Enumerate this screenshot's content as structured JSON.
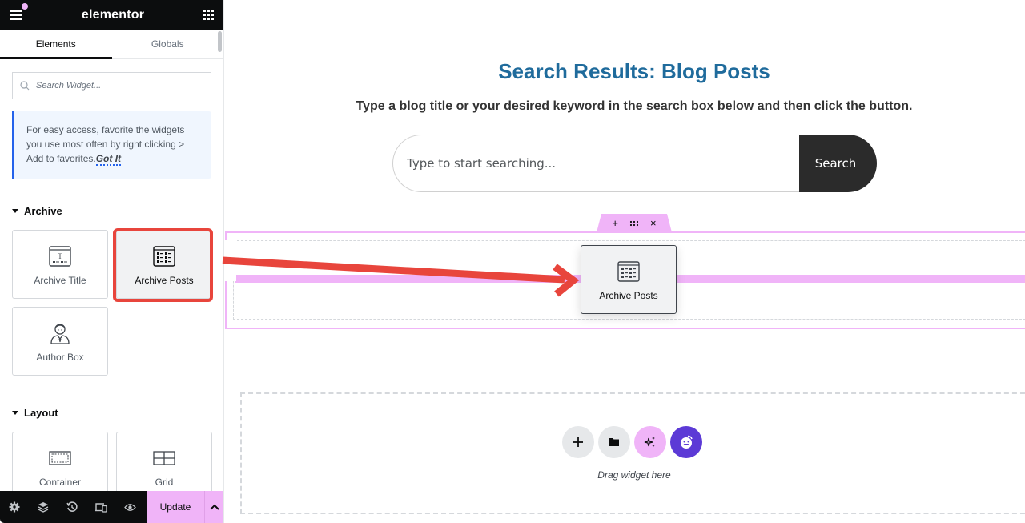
{
  "topbar": {
    "brand": "elementor",
    "menu_icon": "hamburger-icon",
    "apps_icon": "apps-grid-icon",
    "notification_dot_color": "#f0b4f8"
  },
  "panel_tabs": [
    {
      "label": "Elements",
      "active": true
    },
    {
      "label": "Globals",
      "active": false
    }
  ],
  "widget_search": {
    "placeholder": "Search Widget...",
    "value": ""
  },
  "tip": {
    "text": "For easy access, favorite the widgets you use most often by right clicking > Add to favorites.",
    "link": "Got It"
  },
  "sections": [
    {
      "title": "Archive",
      "widgets": [
        {
          "label": "Archive Title",
          "icon": "archive-title-icon"
        },
        {
          "label": "Archive Posts",
          "icon": "archive-posts-icon",
          "highlighted": true
        },
        {
          "label": "Author Box",
          "icon": "author-box-icon"
        }
      ]
    },
    {
      "title": "Layout",
      "widgets": [
        {
          "label": "Container",
          "icon": "container-icon"
        },
        {
          "label": "Grid",
          "icon": "grid-icon"
        }
      ]
    }
  ],
  "bottombar": {
    "icons": [
      "settings-icon",
      "layers-icon",
      "history-icon",
      "responsive-icon",
      "preview-icon"
    ],
    "update_label": "Update",
    "accent_color": "#f0b4f8"
  },
  "canvas": {
    "title": "Search Results: Blog Posts",
    "subtitle": "Type a blog title or your desired keyword in the search box below and then click the button.",
    "search_placeholder": "Type to start searching...",
    "search_value": "",
    "search_button": "Search",
    "container_controls": {
      "add": "+",
      "drag": "⠿",
      "remove": "×"
    },
    "dragged_widget": "Archive Posts",
    "drag_hint": "Drag widget here",
    "title_color": "#1f6b9c",
    "highlight_color": "#e8453c"
  }
}
